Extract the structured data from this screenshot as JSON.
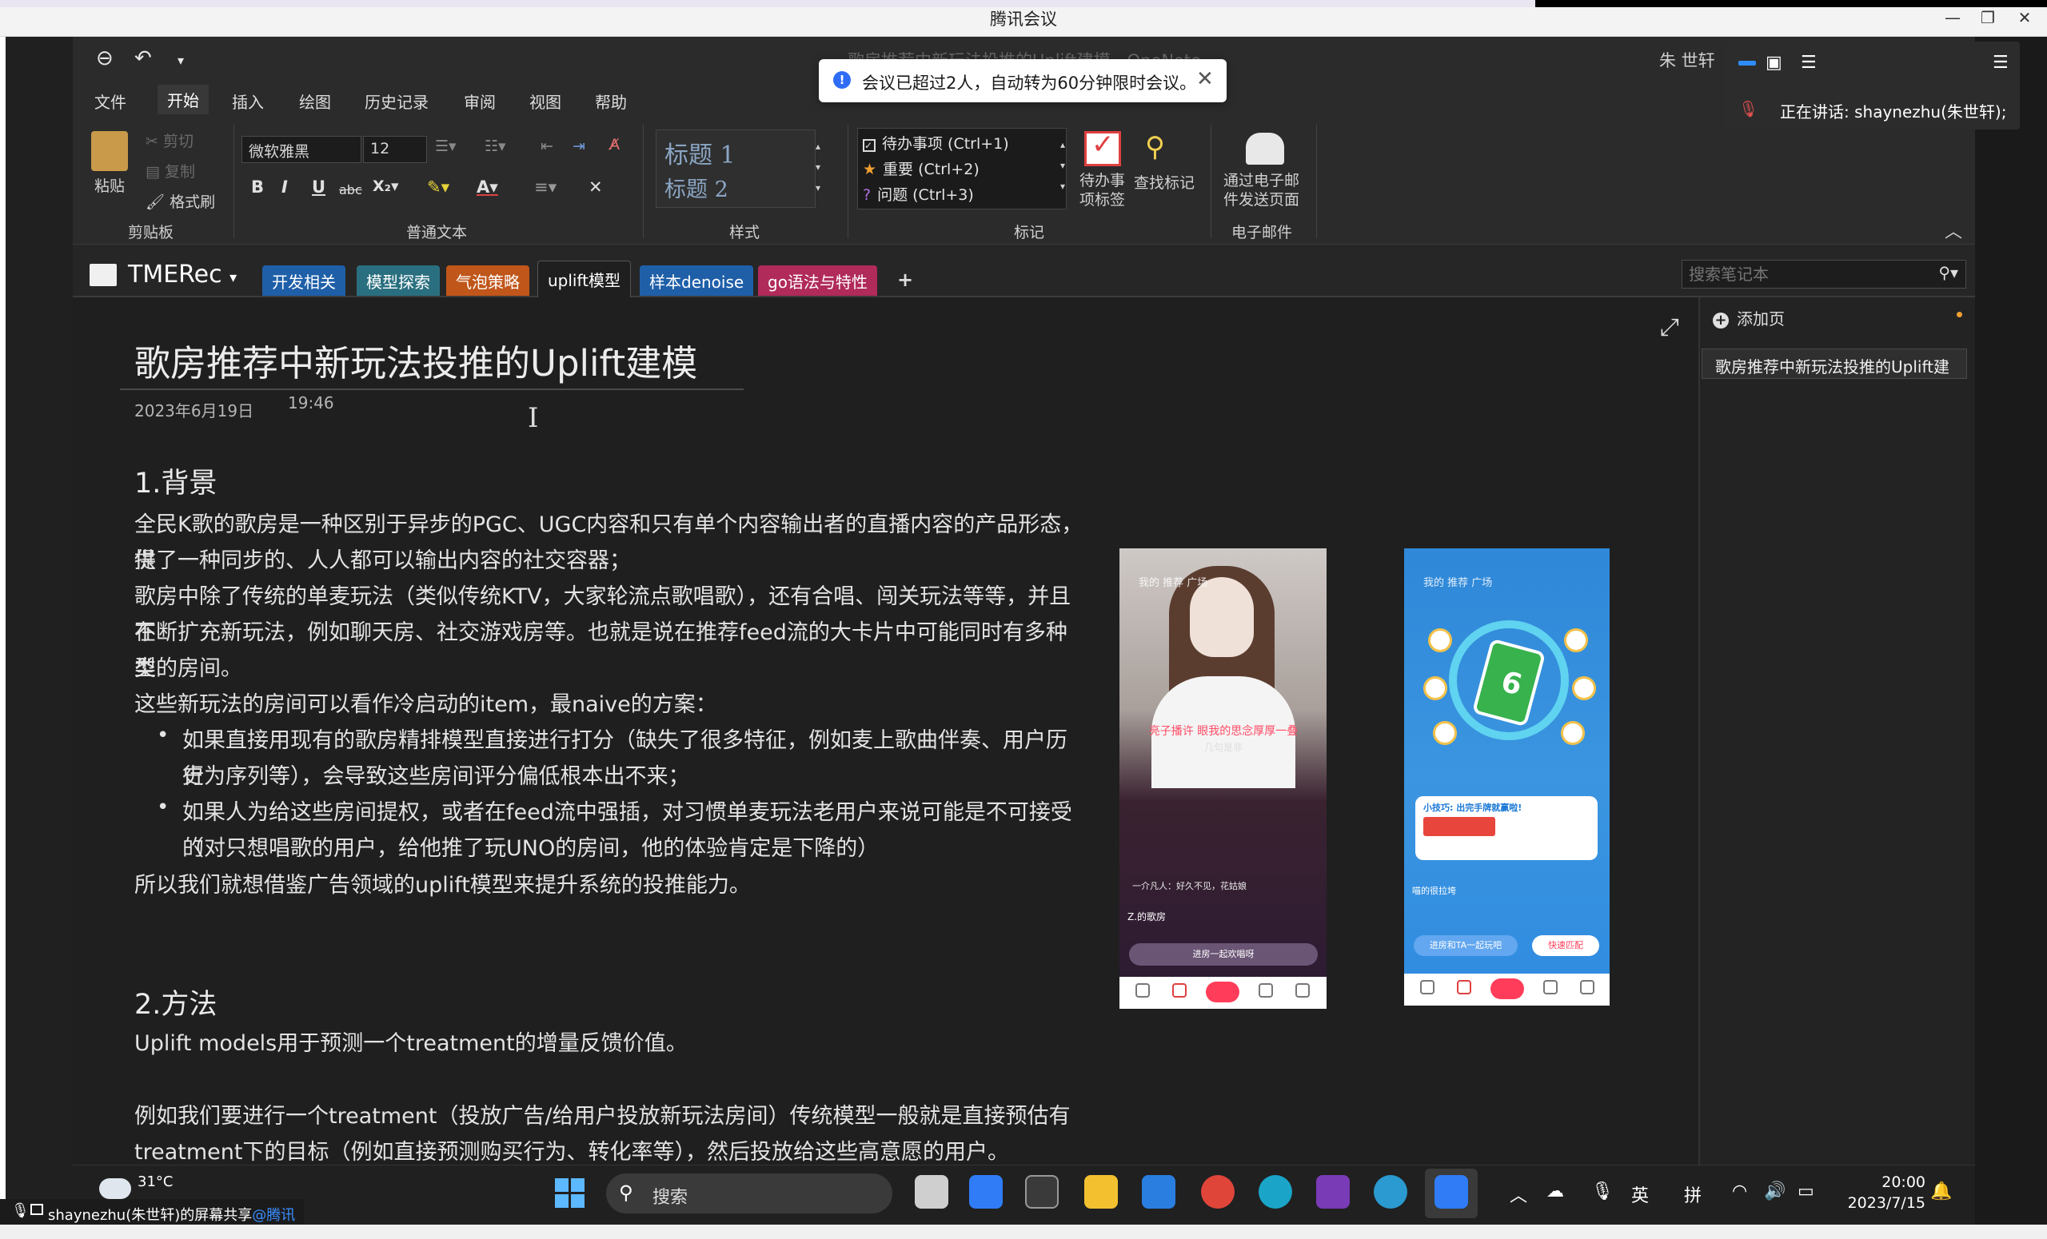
{
  "meeting": {
    "window_title": "腾讯会议"
  },
  "onenote": {
    "ghost_title": "歌房推荐中新玩法投推的Uplift建模 - OneNote",
    "user": "朱 世轩",
    "menu": [
      "文件",
      "开始",
      "插入",
      "绘图",
      "历史记录",
      "审阅",
      "视图",
      "帮助"
    ],
    "ribbon": {
      "clipboard": {
        "paste": "粘贴",
        "cut": "剪切",
        "copy": "复制",
        "format_painter": "格式刷",
        "label": "剪贴板"
      },
      "text": {
        "font": "微软雅黑",
        "size": "12",
        "label": "普通文本"
      },
      "styles": {
        "h1": "标题 1",
        "h2": "标题 2",
        "label": "样式"
      },
      "tags": {
        "todo": "待办事项 (Ctrl+1)",
        "important": "重要 (Ctrl+2)",
        "question": "问题 (Ctrl+3)",
        "todo_tag": "待办事\n项标签",
        "find_tags": "查找标记",
        "label": "标记"
      },
      "email": {
        "send": "通过电子邮\n件发送页面",
        "label": "电子邮件"
      }
    },
    "notebook": "TMERec",
    "sections": [
      {
        "label": "开发相关",
        "color": "#1f5fa8"
      },
      {
        "label": "模型探索",
        "color": "#2a6f80"
      },
      {
        "label": "气泡策略",
        "color": "#c0561a"
      },
      {
        "label": "uplift模型",
        "color": "#1f1f1f"
      },
      {
        "label": "样本denoise",
        "color": "#1f5fa8"
      },
      {
        "label": "go语法与特性",
        "color": "#b02a5a"
      }
    ],
    "search_placeholder": "搜索笔记本",
    "add_page": "添加页",
    "pages": [
      "歌房推荐中新玩法投推的Uplift建"
    ]
  },
  "page": {
    "title": "歌房推荐中新玩法投推的Uplift建模",
    "date": "2023年6月19日",
    "time": "19:46",
    "section1_heading": "1.背景",
    "p1": "全民K歌的歌房是一种区别于异步的PGC、UGC内容和只有单个内容输出者的直播内容的产品形态，提",
    "p1b": "供了一种同步的、人人都可以输出内容的社交容器；",
    "p2": "歌房中除了传统的单麦玩法（类似传统KTV，大家轮流点歌唱歌），还有合唱、闯关玩法等等，并且在",
    "p2b": "不断扩充新玩法，例如聊天房、社交游戏房等。也就是说在推荐feed流的大卡片中可能同时有多种类",
    "p2c": "型的房间。",
    "p3": "这些新玩法的房间可以看作冷启动的item，最naive的方案：",
    "b1": "如果直接用现有的歌房精排模型直接进行打分（缺失了很多特征，例如麦上歌曲伴奏、用户历史",
    "b1b": "行为序列等），会导致这些房间评分偏低根本出不来；",
    "b2": "如果人为给这些房间提权，或者在feed流中强插，对习惯单麦玩法老用户来说可能是不可接受的",
    "b2b": "（对只想唱歌的用户，给他推了玩UNO的房间，他的体验肯定是下降的）",
    "p4": "所以我们就想借鉴广告领域的uplift模型来提升系统的投推能力。",
    "section2_heading": "2.方法",
    "p5": "Uplift models用于预测一个treatment的增量反馈价值。",
    "p6": "例如我们要进行一个treatment（投放广告/给用户投放新玩法房间）传统模型一般就是直接预估有",
    "p6b": "treatment下的目标（例如直接预测购买行为、转化率等），然后投放给这些高意愿的用户。"
  },
  "phone1": {
    "tabs": "我的  推荐  广场",
    "red_text": "亮子播许 眼我的思念厚厚一叠",
    "sub_text": "几句是非",
    "msg": "一介凡人：好久不见，花姑娘",
    "room": "Z.的歌房",
    "join": "进房一起欢唱呀"
  },
  "phone2": {
    "tabs": "我的  推荐  广场",
    "tip": "小技巧: 出完手牌就赢啦!",
    "room": "喵的很拉垮",
    "btn1": "进房和TA一起玩吧",
    "btn2": "快速匹配"
  },
  "toast": {
    "text": "会议已超过2人，自动转为60分钟限时会议。"
  },
  "speaker": {
    "text": "正在讲话:  shaynezhu(朱世轩);"
  },
  "taskbar": {
    "temp": "31°C",
    "search": "搜索",
    "ime1": "英",
    "ime2": "拼",
    "time": "20:00",
    "date": "2023/7/15"
  },
  "share": {
    "text": "shaynezhu(朱世轩)的屏幕共享",
    "link": "@腾讯"
  }
}
